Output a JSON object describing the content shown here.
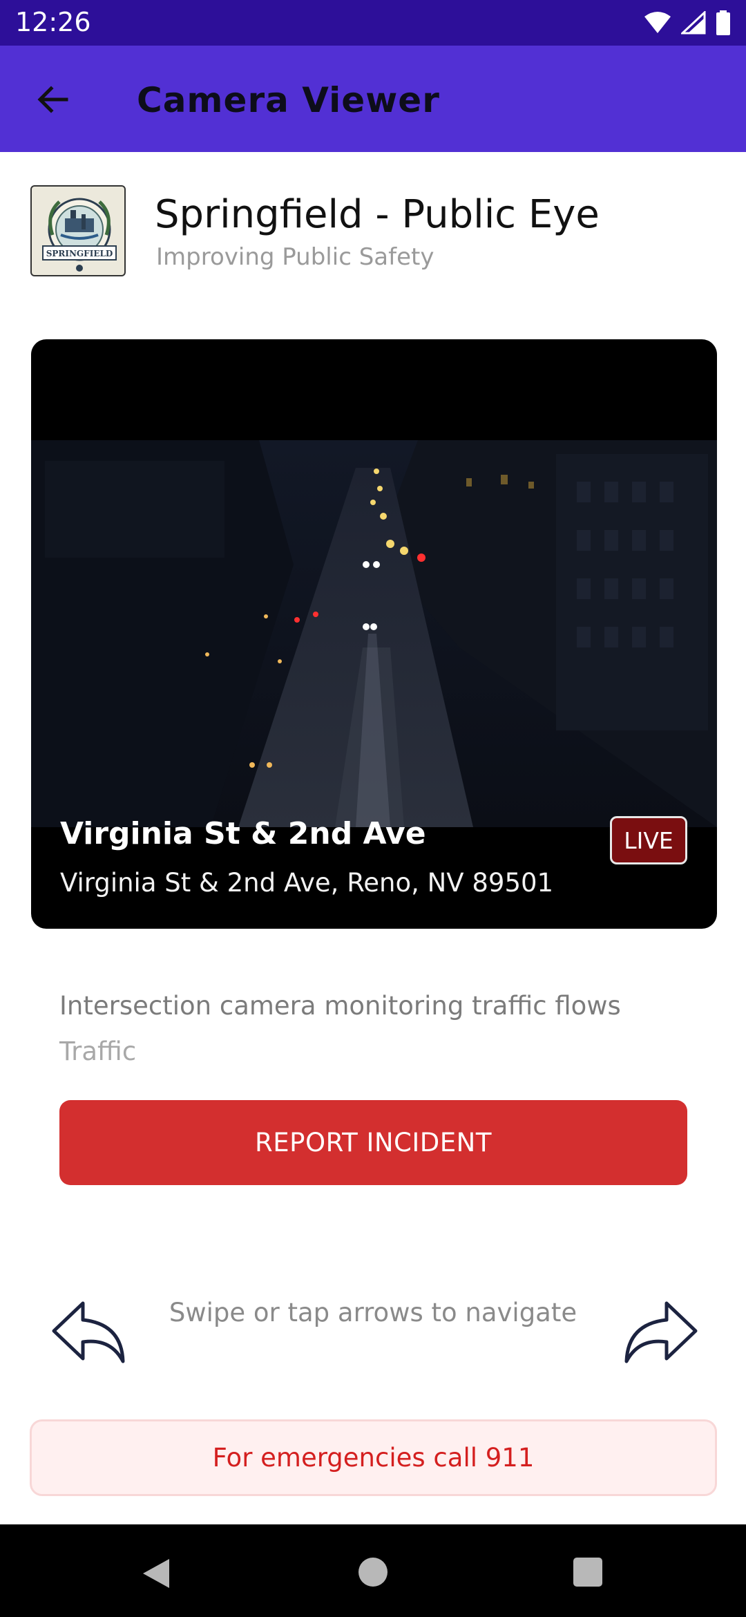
{
  "status_bar": {
    "time": "12:26"
  },
  "app_bar": {
    "title": "Camera Viewer"
  },
  "organization": {
    "name": "Springfield - Public Eye",
    "tagline": "Improving Public Safety",
    "logo_text": "SPRINGFIELD"
  },
  "camera": {
    "name": "Virginia St & 2nd Ave",
    "address": "Virginia St & 2nd Ave, Reno, NV 89501",
    "status_badge": "LIVE",
    "description": "Intersection camera monitoring traffic flows",
    "category": "Traffic"
  },
  "actions": {
    "report_label": "REPORT INCIDENT"
  },
  "navigation": {
    "hint": "Swipe or tap arrows to navigate"
  },
  "emergency": {
    "text": "For emergencies call 911"
  },
  "colors": {
    "status_bar": "#2d0f99",
    "app_bar": "#5230d4",
    "report_button": "#d32f2f",
    "live_badge": "#7a0e10",
    "emergency_text": "#d41f1f",
    "emergency_bg": "#fff0f0"
  },
  "icons": {
    "back": "arrow-left-icon",
    "prev": "reply-arrow-icon",
    "next": "forward-arrow-icon",
    "wifi": "wifi-icon",
    "signal": "cell-signal-icon",
    "battery": "battery-icon"
  }
}
